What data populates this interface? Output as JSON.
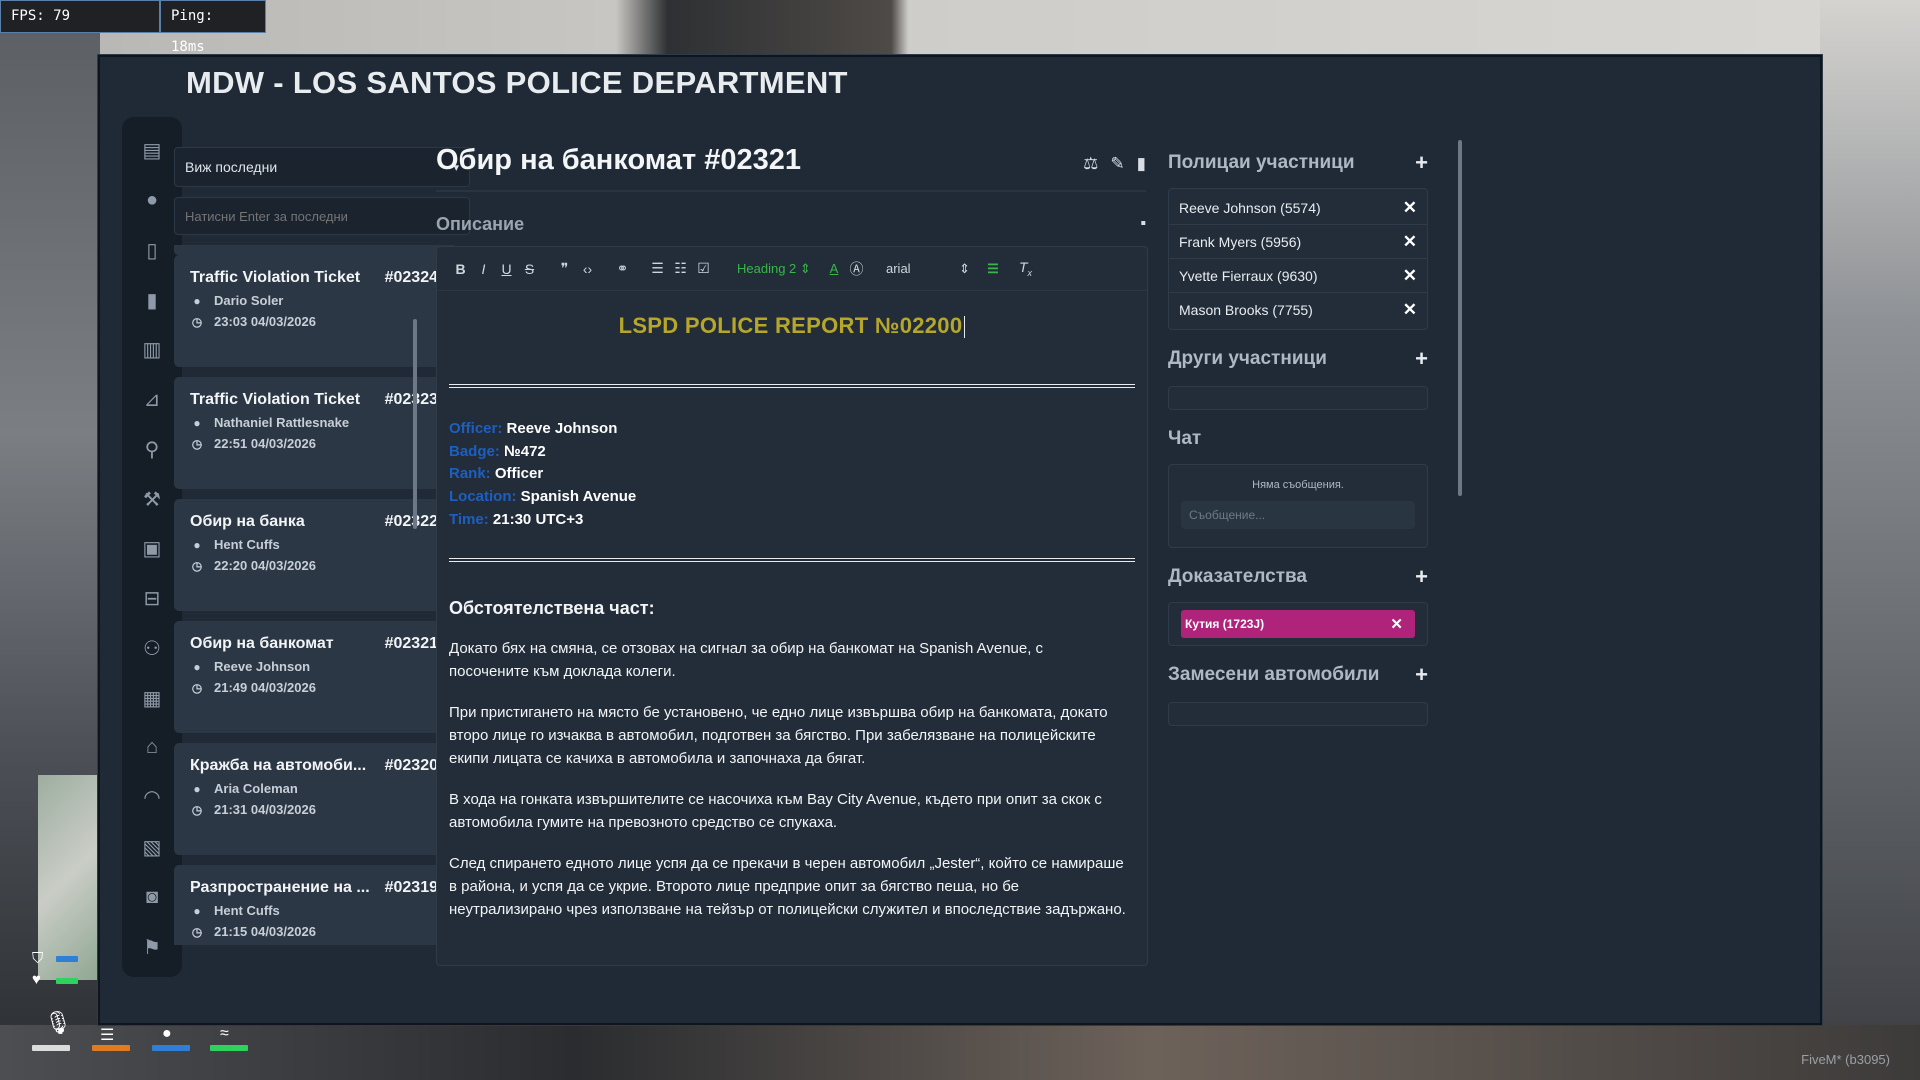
{
  "overlay": {
    "fps": "FPS: 79",
    "ping": "Ping: 18ms"
  },
  "window": {
    "title": "MDW - LOS SANTOS POLICE DEPARTMENT"
  },
  "nav": {
    "icons": [
      "newspaper-icon",
      "user-icon",
      "file-icon",
      "document-icon",
      "receipt-icon",
      "car-crash-icon",
      "user-lock-icon",
      "gavel-icon",
      "briefcase-icon",
      "car-icon",
      "users-icon",
      "building-icon",
      "home-icon",
      "headset-icon",
      "images-icon",
      "camera-icon",
      "flag-icon"
    ]
  },
  "list": {
    "filter_value": "Виж последни",
    "search_placeholder": "Натисни Enter за последни",
    "items": [
      {
        "title": "Traffic Violation Ticket",
        "id": "#02324",
        "person": "Dario Soler",
        "time": "23:03 04/03/2026"
      },
      {
        "title": "Traffic Violation Ticket",
        "id": "#02323",
        "person": "Nathaniel Rattlesnake",
        "time": "22:51 04/03/2026"
      },
      {
        "title": "Обир на банка",
        "id": "#02322",
        "person": "Hent Cuffs",
        "time": "22:20 04/03/2026"
      },
      {
        "title": "Обир на банкомат",
        "id": "#02321",
        "person": "Reeve Johnson",
        "time": "21:49 04/03/2026"
      },
      {
        "title": "Кражба на автомоби...",
        "id": "#02320",
        "person": "Aria Coleman",
        "time": "21:31 04/03/2026"
      },
      {
        "title": "Разпространение на ...",
        "id": "#02319",
        "person": "Hent Cuffs",
        "time": "21:15 04/03/2026"
      }
    ]
  },
  "report": {
    "title": "Обир на банкомат #02321",
    "description_label": "Описание",
    "toolbar": {
      "heading": "Heading 2",
      "font": "arial"
    },
    "doc_title": "LSPD POLICE REPORT №02200",
    "info": [
      {
        "key": "Officer:",
        "value": "Reeve Johnson"
      },
      {
        "key": "Badge:",
        "value": "№472"
      },
      {
        "key": "Rank:",
        "value": "Officer"
      },
      {
        "key": "Location:",
        "value": "Spanish Avenue"
      },
      {
        "key": "Time:",
        "value": "21:30 UTC+3"
      }
    ],
    "section_heading": "Обстоятелствена част:",
    "paragraphs": [
      "Докато бях на смяна, се отзовах на сигнал за обир на банкомат на Spanish Avenue, с посочените към доклада колеги.",
      "При пристигането на място бе установено, че едно лице извършва обир на банкомата, докато второ лице го изчаква в автомобил, подготвен за бягство. При забелязване на полицейските екипи лицата се качиха в автомобила и започнаха да бягат.",
      "В хода на гонката извършителите се насочиха към Bay City Avenue, където при опит за скок с автомобила гумите на превозното средство се спукаха.",
      "След спирането едното лице успя да се прекачи в черен автомобил „Jester“, който се намираше в района, и успя да се укрие. Второто лице предприе опит за бягство пеша, но бе неутрализирано чрез използване на тейзър от полицейски служител и впоследствие задържано."
    ]
  },
  "right": {
    "officers_label": "Полицаи участници",
    "officers": [
      "Reeve Johnson (5574)",
      "Frank Myers (5956)",
      "Yvette Fierraux (9630)",
      "Mason Brooks (7755)"
    ],
    "others_label": "Други участници",
    "chat_label": "Чат",
    "chat_empty": "Няма съобщения.",
    "chat_placeholder": "Съобщение...",
    "evidence_label": "Доказателства",
    "evidence": [
      {
        "label": "Кутия (1723J)",
        "color": "#b0237a"
      }
    ],
    "vehicles_label": "Замесени автомобили"
  },
  "footer": {
    "watermark": "FiveM* (b3095)"
  }
}
